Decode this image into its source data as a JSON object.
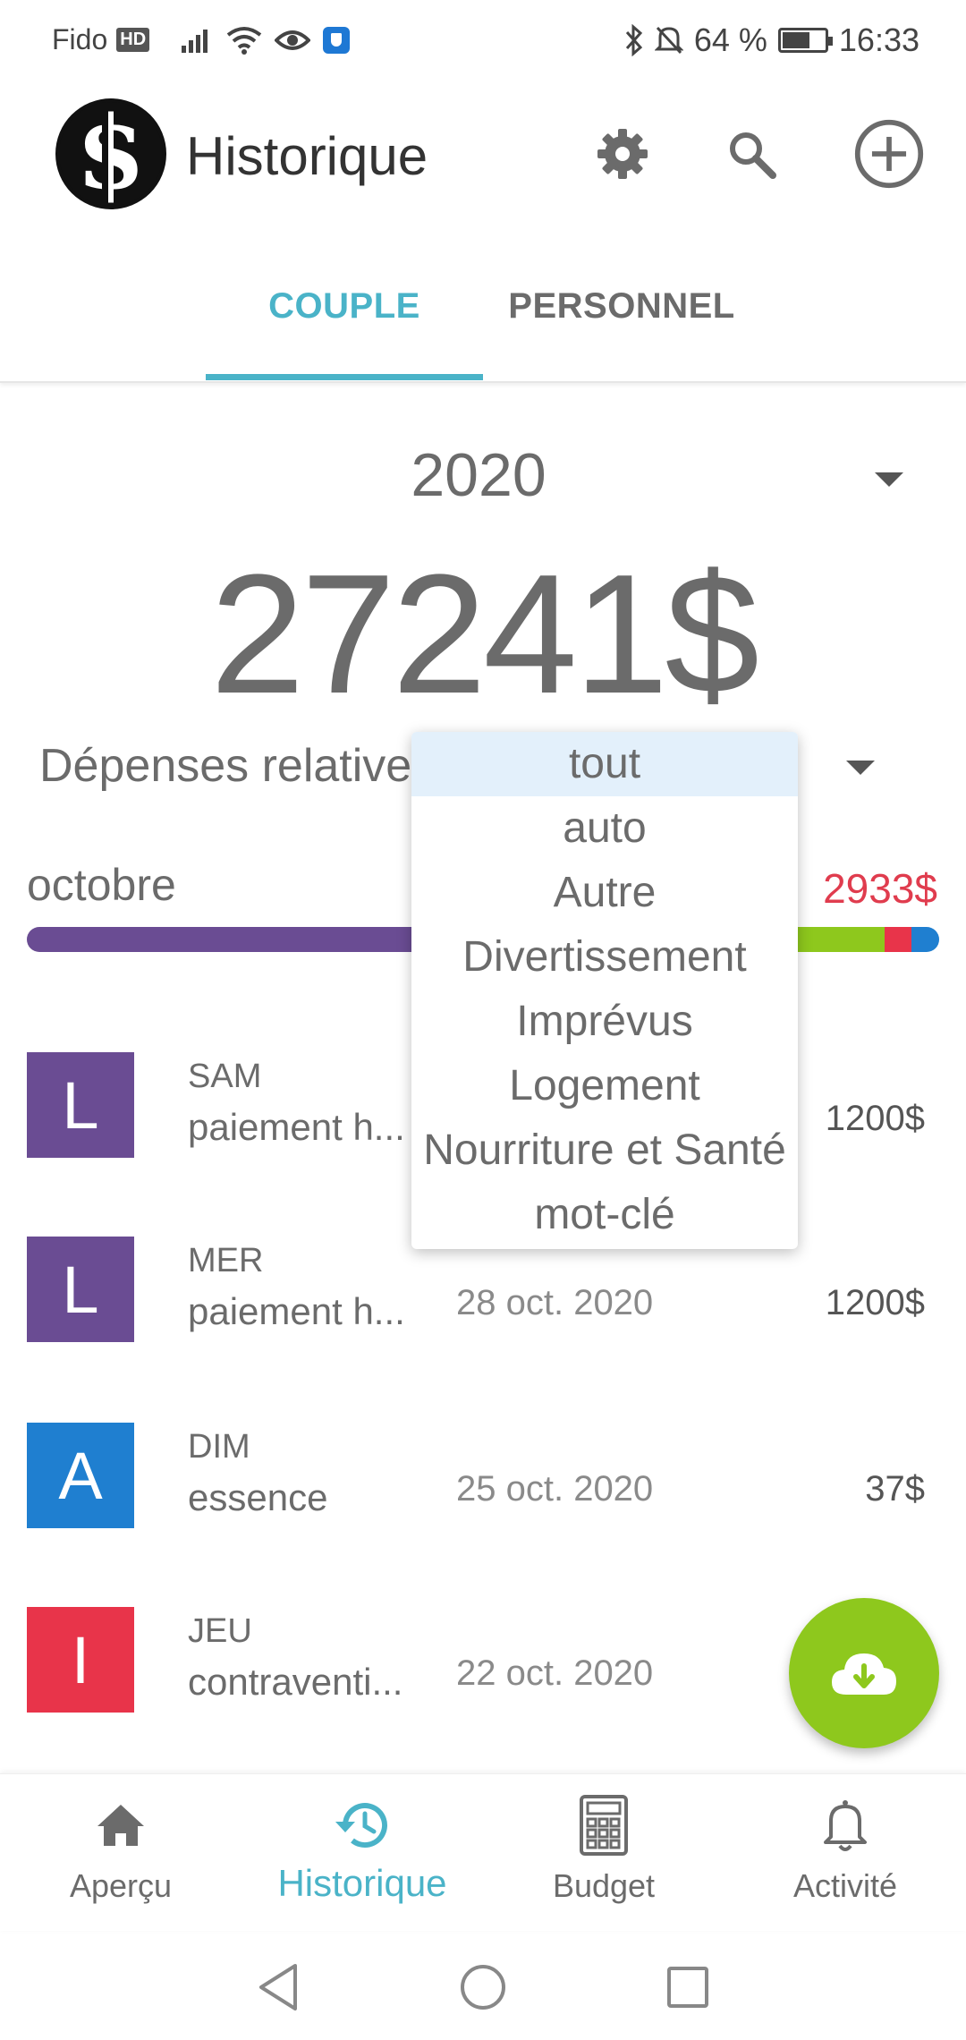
{
  "status_bar": {
    "carrier": "Fido",
    "carrier_badge": "HD",
    "battery": "64 %",
    "time": "16:33"
  },
  "header": {
    "title": "Historique",
    "icons": [
      "settings-icon",
      "search-icon",
      "add-circle-icon"
    ]
  },
  "tabs": [
    {
      "label": "COUPLE",
      "active": true
    },
    {
      "label": "PERSONNEL",
      "active": false
    }
  ],
  "summary": {
    "year": "2020",
    "total": "27241$",
    "filter_label": "Dépenses relatives à"
  },
  "month": {
    "label": "octobre",
    "amount": "2933$",
    "bar": [
      {
        "color": "#6a4c93",
        "fraction": 0.64
      },
      {
        "color": "#8ec81d",
        "fraction": 0.3
      },
      {
        "color": "#e8344a",
        "fraction": 0.03
      },
      {
        "color": "#1f7fd0",
        "fraction": 0.03
      }
    ]
  },
  "transactions": [
    {
      "letter": "L",
      "color": "#6a4c93",
      "day": "SAM",
      "desc": "paiement h...",
      "date": "",
      "amount": "1200$"
    },
    {
      "letter": "L",
      "color": "#6a4c93",
      "day": "MER",
      "desc": "paiement h...",
      "date": "28 oct. 2020",
      "amount": "1200$"
    },
    {
      "letter": "A",
      "color": "#1f7fd0",
      "day": "DIM",
      "desc": "essence",
      "date": "25 oct. 2020",
      "amount": "37$"
    },
    {
      "letter": "I",
      "color": "#e8344a",
      "day": "JEU",
      "desc": "contraventi...",
      "date": "22 oct. 2020",
      "amount": ""
    }
  ],
  "dropdown": {
    "options": [
      "tout",
      "auto",
      "Autre",
      "Divertissement",
      "Imprévus",
      "Logement",
      "Nourriture et Santé",
      "mot-clé"
    ],
    "selected": "tout"
  },
  "fab": {
    "icon": "cloud-download-icon"
  },
  "bottom_nav": [
    {
      "label": "Aperçu",
      "icon": "home-icon",
      "active": false
    },
    {
      "label": "Historique",
      "icon": "history-icon",
      "active": true
    },
    {
      "label": "Budget",
      "icon": "calculator-icon",
      "active": false
    },
    {
      "label": "Activité",
      "icon": "bell-icon",
      "active": false
    }
  ],
  "colors": {
    "accent": "#4ab3c8",
    "fab": "#8ec81d",
    "negative": "#e03c4e"
  }
}
